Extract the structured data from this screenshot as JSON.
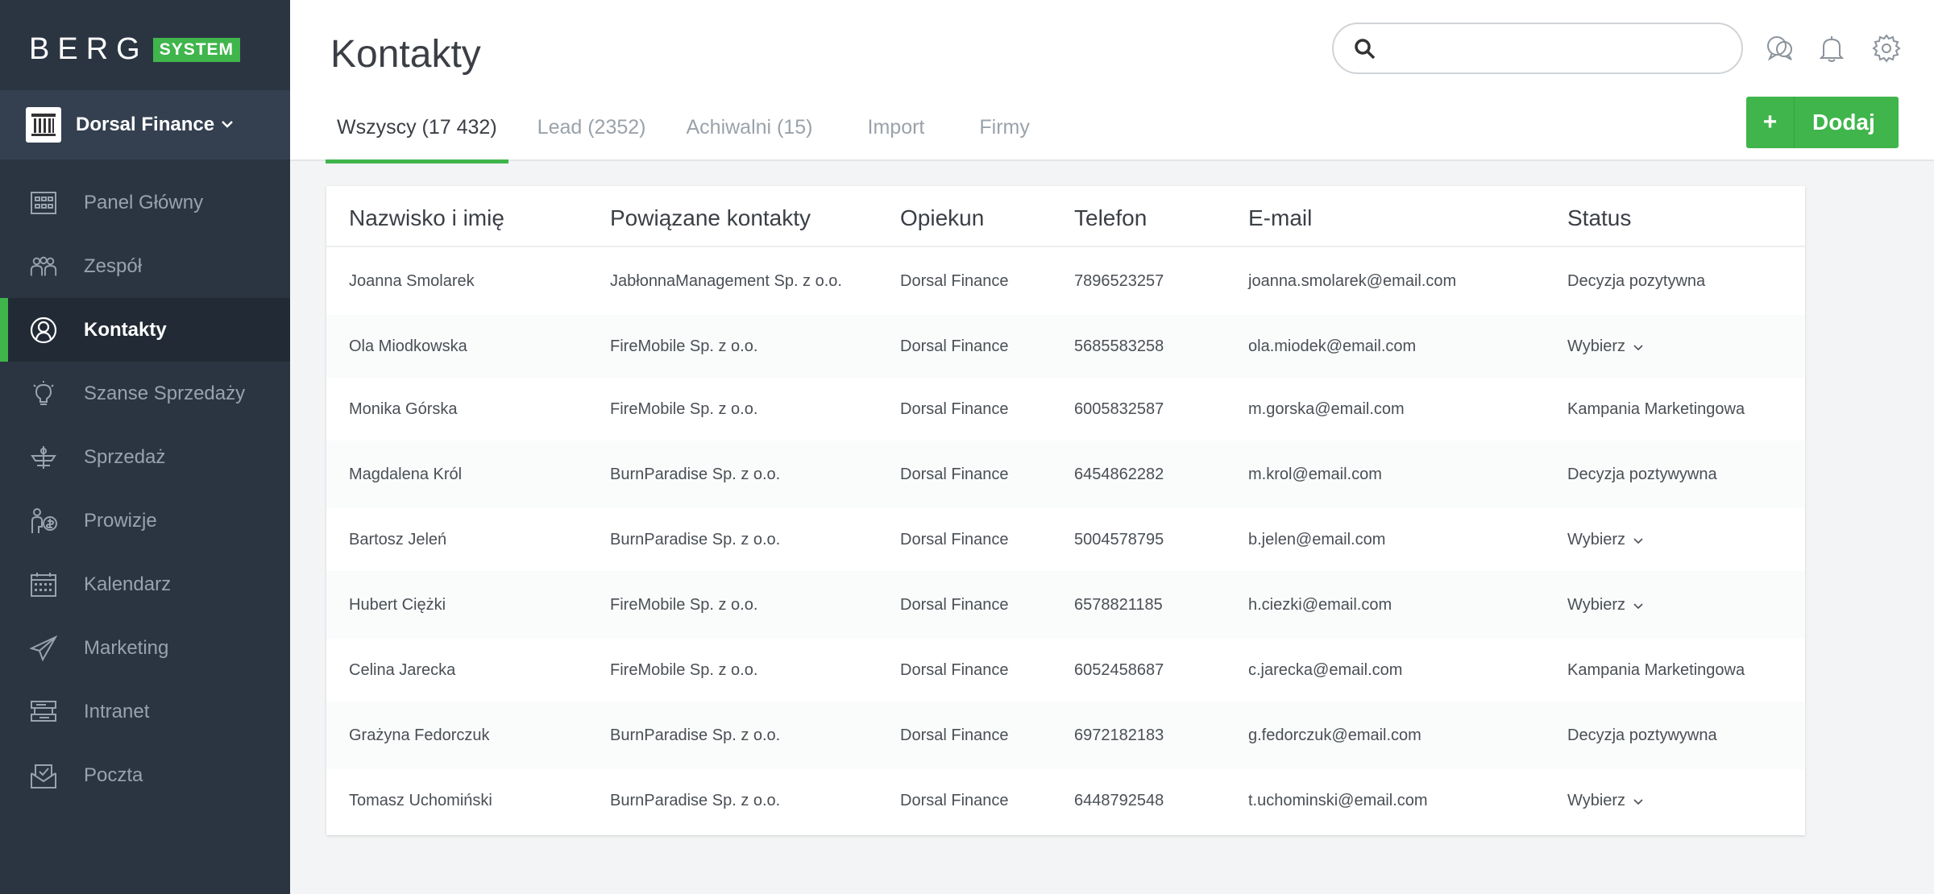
{
  "brand": {
    "word": "BERG",
    "tag": "SYSTEM",
    "accent": "#3fb54b"
  },
  "org": {
    "name": "Dorsal Finance"
  },
  "nav": [
    {
      "label": "Panel Główny",
      "icon": "dashboard-icon"
    },
    {
      "label": "Zespół",
      "icon": "team-icon"
    },
    {
      "label": "Kontakty",
      "icon": "contacts-icon",
      "active": true
    },
    {
      "label": "Szanse Sprzedaży",
      "icon": "lightbulb-icon"
    },
    {
      "label": "Sprzedaż",
      "icon": "sales-icon"
    },
    {
      "label": "Prowizje",
      "icon": "commission-icon"
    },
    {
      "label": "Kalendarz",
      "icon": "calendar-icon"
    },
    {
      "label": "Marketing",
      "icon": "paper-plane-icon"
    },
    {
      "label": "Intranet",
      "icon": "intranet-icon"
    },
    {
      "label": "Poczta",
      "icon": "mail-icon"
    }
  ],
  "header": {
    "title": "Kontakty",
    "search_placeholder": "",
    "tabs": [
      {
        "label": "Wszyscy (17 432)",
        "active": true
      },
      {
        "label": "Lead (2352)"
      },
      {
        "label": "Achiwalni (15)"
      },
      {
        "label": "Import"
      },
      {
        "label": "Firmy"
      }
    ],
    "add_plus": "+",
    "add_label": "Dodaj"
  },
  "table": {
    "columns": [
      "Nazwisko i imię",
      "Powiązane kontakty",
      "Opiekun",
      "Telefon",
      "E-mail",
      "Status"
    ],
    "rows": [
      [
        "Joanna Smolarek",
        "JabłonnaManagement Sp. z o.o.",
        "Dorsal Finance",
        "7896523257",
        "joanna.smolarek@email.com",
        "Decyzja pozytywna"
      ],
      [
        "Ola Miodkowska",
        "FireMobile Sp. z o.o.",
        "Dorsal Finance",
        "5685583258",
        "ola.miodek@email.com",
        "Wybierz"
      ],
      [
        "Monika Górska",
        "FireMobile Sp. z o.o.",
        "Dorsal Finance",
        "6005832587",
        "m.gorska@email.com",
        "Kampania Marketingowa"
      ],
      [
        "Magdalena Król",
        "BurnParadise Sp. z o.o.",
        "Dorsal Finance",
        "6454862282",
        "m.krol@email.com",
        "Decyzja poztywywna"
      ],
      [
        "Bartosz Jeleń",
        "BurnParadise Sp. z o.o.",
        "Dorsal Finance",
        "5004578795",
        "b.jelen@email.com",
        "Wybierz"
      ],
      [
        "Hubert Ciężki",
        "FireMobile Sp. z o.o.",
        "Dorsal Finance",
        "6578821185",
        "h.ciezki@email.com",
        "Wybierz"
      ],
      [
        "Celina Jarecka",
        "FireMobile Sp. z o.o.",
        "Dorsal Finance",
        "6052458687",
        "c.jarecka@email.com",
        "Kampania Marketingowa"
      ],
      [
        "Grażyna Fedorczuk",
        "BurnParadise Sp. z o.o.",
        "Dorsal Finance",
        "6972182183",
        "g.fedorczuk@email.com",
        "Decyzja poztywywna"
      ],
      [
        "Tomasz Uchomiński",
        "BurnParadise Sp. z o.o.",
        "Dorsal Finance",
        "6448792548",
        "t.uchominski@email.com",
        "Wybierz"
      ]
    ]
  }
}
